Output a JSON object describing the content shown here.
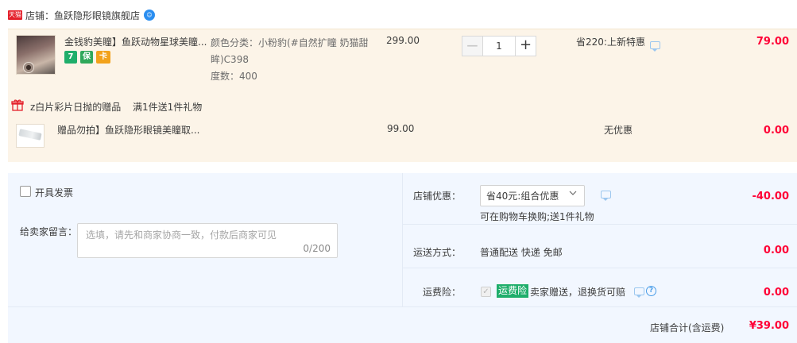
{
  "shop": {
    "badge": "天猫",
    "name": "店铺：鱼跃隐形眼镜旗舰店",
    "chat_icon": "wangwang-chat-icon"
  },
  "item": {
    "title": "金钱豹美瞳】鱼跃动物星球美瞳...",
    "sku_color": "颜色分类：小粉豹(#自然扩瞳 奶猫甜眸)C398",
    "sku_degree": "度数：400",
    "price": "299.00",
    "quantity": "1",
    "promo": "省220:上新特惠",
    "total": "79.00",
    "badges": [
      "7",
      "保",
      "卡"
    ]
  },
  "gift": {
    "header_label": "z白片彩片日抛的赠品",
    "header_rule": "满1件送1件礼物",
    "title": "赠品勿拍】鱼跃隐形眼镜美瞳取...",
    "price": "99.00",
    "promo": "无优惠",
    "total": "0.00"
  },
  "order": {
    "invoice_label": "开具发票",
    "message_label": "给卖家留言：",
    "message_placeholder": "选填，请先和商家协商一致，付款后商家可见",
    "message_count": "0/200",
    "discount_label": "店铺优惠：",
    "discount_selected": "省40元:组合优惠",
    "discount_note": "可在购物车换购;送1件礼物",
    "discount_value": "-40.00",
    "shipping_label": "运送方式：",
    "shipping_text": "普通配送 快递 免邮",
    "shipping_value": "0.00",
    "insurance_label": "运费险：",
    "insurance_badge": "运费险",
    "insurance_text": "卖家赠送，退换货可赔",
    "insurance_value": "0.00",
    "sum_label": "店铺合计(含运费)",
    "sum_value": "¥39.00"
  },
  "colors": {
    "accent_red": "#ff0036",
    "panel_bg": "#f2f7ff",
    "item_bg": "#fcf4e8",
    "badge_green": "#1fae6b"
  }
}
